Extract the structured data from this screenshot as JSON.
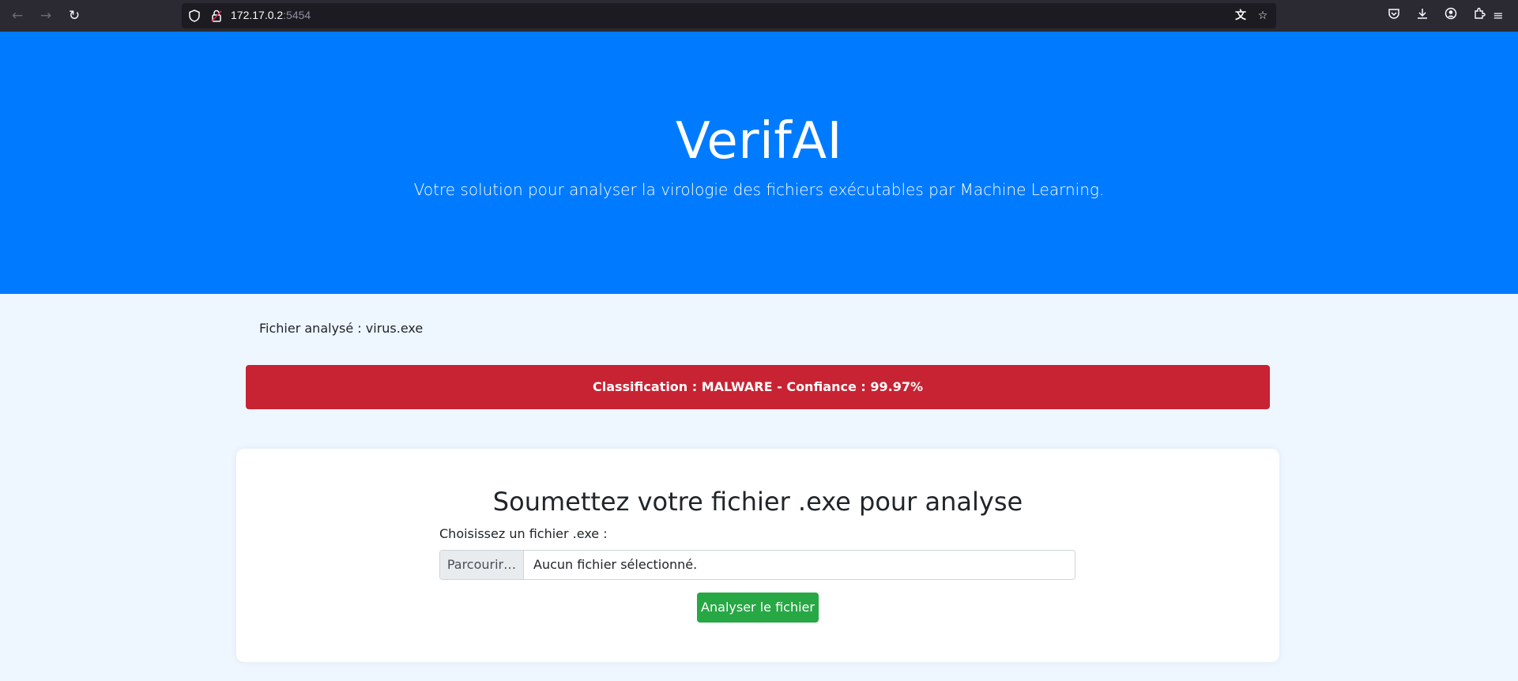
{
  "browser": {
    "url_host": "172.17.0.2",
    "url_port": ":5454"
  },
  "hero": {
    "title": "VerifAI",
    "subtitle": "Votre solution pour analyser la virologie des fichiers exécutables par Machine Learning."
  },
  "result": {
    "file_label": "Fichier analysé : virus.exe",
    "classification": "Classification : MALWARE - Confiance : 99.97%"
  },
  "upload": {
    "heading": "Soumettez votre fichier .exe pour analyse",
    "field_label": "Choisissez un fichier .exe :",
    "browse_label": "Parcourir…",
    "file_status": "Aucun fichier sélectionné.",
    "submit_label": "Analyser le fichier"
  },
  "colors": {
    "hero_bg": "#007bff",
    "alert_bg": "#c82333",
    "submit_bg": "#28a745",
    "page_bg": "#eef6ff"
  }
}
